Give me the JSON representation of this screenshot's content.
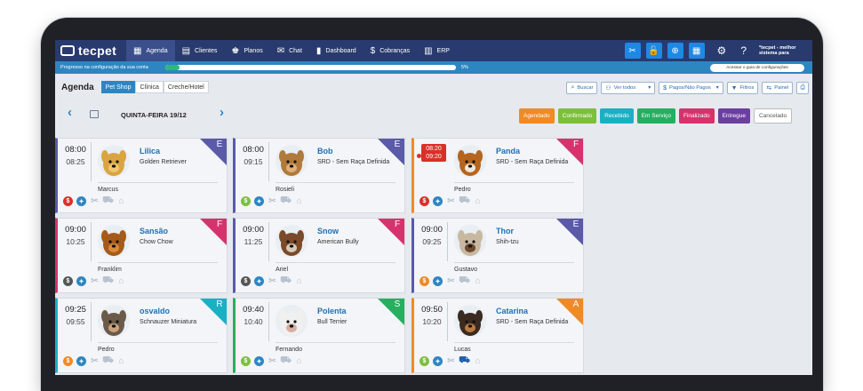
{
  "app": {
    "logo": "tecpet"
  },
  "nav": [
    {
      "label": "Agenda",
      "icon": "calendar-icon",
      "glyph": "▦",
      "active": true
    },
    {
      "label": "Clientes",
      "icon": "clients-icon",
      "glyph": "▤"
    },
    {
      "label": "Planos",
      "icon": "plans-icon",
      "glyph": "♚"
    },
    {
      "label": "Chat",
      "icon": "chat-icon",
      "glyph": "✉"
    },
    {
      "label": "Dashboard",
      "icon": "dashboard-icon",
      "glyph": "▮"
    },
    {
      "label": "Cobranças",
      "icon": "billing-icon",
      "glyph": "$"
    },
    {
      "label": "ERP",
      "icon": "erp-icon",
      "glyph": "▥"
    }
  ],
  "user": {
    "name": "*tecpet - melhor sistema para"
  },
  "progress": {
    "label": "Progresso na configuração da sua conta",
    "percent_text": "5%",
    "value": 0.05,
    "button": "Acessar o guia de configurações"
  },
  "header": {
    "title": "Agenda",
    "tabs": [
      {
        "label": "Pet Shop",
        "active": true
      },
      {
        "label": "Clínica"
      },
      {
        "label": "Creche/Hotel"
      }
    ],
    "tools": {
      "search": "Buscar",
      "view_all": "Ver todos",
      "paid": "Pagos/Não Pagos",
      "filters": "Filtros",
      "panel": "Painel"
    }
  },
  "date": {
    "label": "QUINTA-FEIRA 19/12"
  },
  "statuses": [
    {
      "label": "Agendado",
      "color": "#f08a24"
    },
    {
      "label": "Confirmado",
      "color": "#7cbf3c"
    },
    {
      "label": "Recebido",
      "color": "#1ab0c4"
    },
    {
      "label": "Em Serviço",
      "color": "#27ae60"
    },
    {
      "label": "Finalizado",
      "color": "#d6336c"
    },
    {
      "label": "Entregue",
      "color": "#6b3fa0"
    },
    {
      "label": "Cancelado",
      "color": "outline"
    }
  ],
  "cards": [
    {
      "start": "08:00",
      "end": "08:25",
      "name": "Lilica",
      "breed": "Golden Retriever",
      "owner": "Marcus",
      "letter": "E",
      "corner_color": "#5a5aa8",
      "border_color": "#5a5aa8",
      "pay_color": "#d9302a",
      "late": false
    },
    {
      "start": "08:00",
      "end": "09:15",
      "name": "Bob",
      "breed": "SRD - Sem Raça Definida",
      "owner": "Rosieli",
      "letter": "E",
      "corner_color": "#5a5aa8",
      "border_color": "#5a5aa8",
      "pay_color": "#7cbf3c",
      "late": false
    },
    {
      "start": "08:20",
      "end": "09:20",
      "name": "Panda",
      "breed": "SRD - Sem Raça Definida",
      "owner": "Pedro",
      "letter": "F",
      "corner_color": "#d6336c",
      "border_color": "#f08a24",
      "pay_color": "#d9302a",
      "late": true
    },
    {
      "start": "09:00",
      "end": "10:25",
      "name": "Sansão",
      "breed": "Chow Chow",
      "owner": "Franklim",
      "letter": "F",
      "corner_color": "#d6336c",
      "border_color": "#d6336c",
      "pay_color": "#555555",
      "late": false
    },
    {
      "start": "09:00",
      "end": "11:25",
      "name": "Snow",
      "breed": "American Bully",
      "owner": "Ariel",
      "letter": "F",
      "corner_color": "#d6336c",
      "border_color": "#5a5aa8",
      "pay_color": "#555555",
      "late": false
    },
    {
      "start": "09:00",
      "end": "09:25",
      "name": "Thor",
      "breed": "Shih-tzu",
      "owner": "Gustavo",
      "letter": "E",
      "corner_color": "#5a5aa8",
      "border_color": "#5a5aa8",
      "pay_color": "#f08a24",
      "late": false
    },
    {
      "start": "09:25",
      "end": "09:55",
      "name": "osvaldo",
      "breed": "Schnauzer Miniatura",
      "owner": "Pedro",
      "letter": "R",
      "corner_color": "#1ab0c4",
      "border_color": "#1ab0c4",
      "pay_color": "#f08a24",
      "late": false
    },
    {
      "start": "09:40",
      "end": "10:40",
      "name": "Polenta",
      "breed": "Bull Terrier",
      "owner": "Fernando",
      "letter": "S",
      "corner_color": "#27ae60",
      "border_color": "#27ae60",
      "pay_color": "#7cbf3c",
      "late": false
    },
    {
      "start": "09:50",
      "end": "10:20",
      "name": "Catarina",
      "breed": "SRD - Sem Raça Definida",
      "owner": "Lucas",
      "letter": "A",
      "corner_color": "#f08a24",
      "border_color": "#f08a24",
      "pay_color": "#7cbf3c",
      "late": false
    }
  ]
}
